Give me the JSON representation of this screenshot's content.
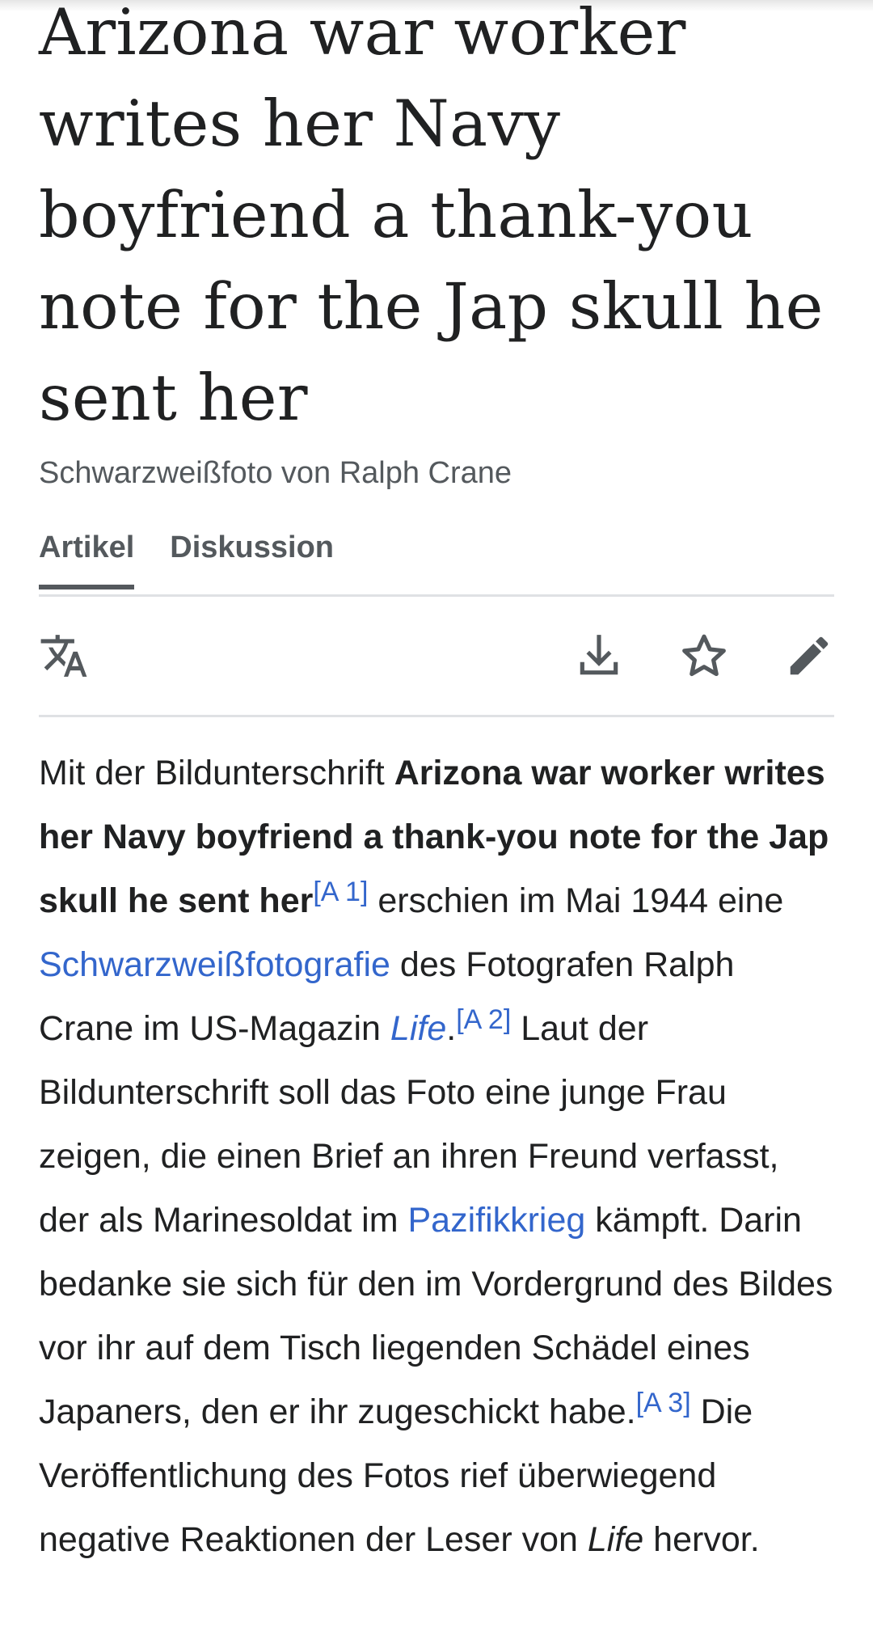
{
  "article": {
    "title": "Arizona war worker writes her Navy boyfriend a thank-you note for the Jap skull he sent her",
    "subtitle": "Schwarzweißfoto von Ralph Crane"
  },
  "tabs": [
    {
      "label": "Artikel",
      "active": true
    },
    {
      "label": "Diskussion",
      "active": false
    }
  ],
  "toolbar": {
    "icons": [
      "language-icon",
      "download-icon",
      "star-icon",
      "edit-icon"
    ]
  },
  "body": {
    "p1_intro": "Mit der Bildunterschrift ",
    "p1_caption_bold": "Arizona war worker writes her Navy boyfriend a thank-you note for the Jap skull he sent her",
    "ref_a1": "[A 1]",
    "p1_after_ref1": " erschien im Mai 1944 eine ",
    "link_schwarzweiss": "Schwarzweißfotografie",
    "p1_after_link1": " des Fotografen Ralph Crane im US-Magazin ",
    "link_life": "Life",
    "p1_period": ".",
    "ref_a2": "[A 2]",
    "p1_after_ref2": " Laut der Bildunterschrift soll das Foto eine junge Frau zeigen, die einen Brief an ihren Freund verfasst, der als Marinesoldat im ",
    "link_pazifikkrieg": "Pazifikkrieg",
    "p1_after_link2": " kämpft. Darin bedanke sie sich für den im Vordergrund des Bildes vor ihr auf dem Tisch liegenden Schädel eines Japaners, den er ihr zugeschickt habe.",
    "ref_a3": "[A 3]",
    "p1_after_ref3": " Die Veröffentlichung des Fotos rief überwiegend negative Reaktionen der Leser von ",
    "life_italic": "Life",
    "p1_end": " hervor."
  },
  "colors": {
    "text": "#202122",
    "muted": "#54595d",
    "link": "#3366cc",
    "divider": "#dfe1e4"
  }
}
